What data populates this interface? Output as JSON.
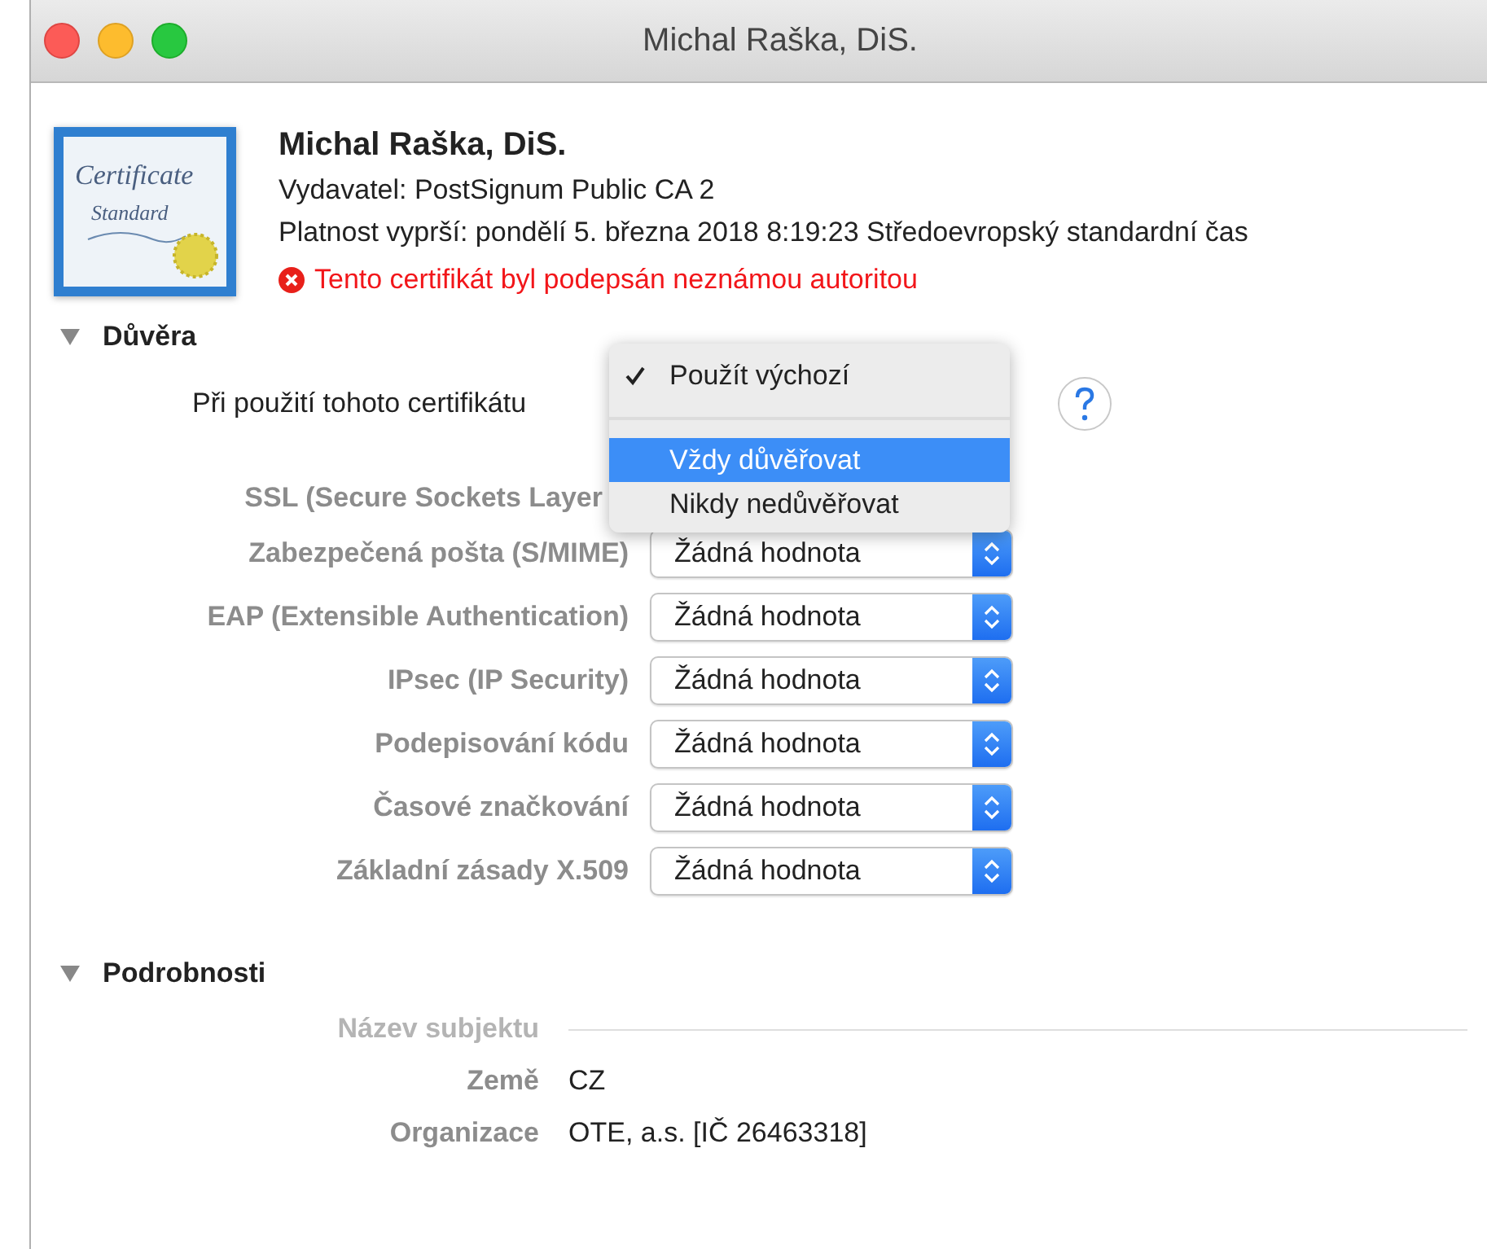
{
  "window": {
    "title": "Michal Raška, DiS."
  },
  "certificate": {
    "icon_lines": [
      "Certificate",
      "Standard"
    ],
    "name": "Michal Raška, DiS.",
    "issuer": "Vydavatel: PostSignum Public CA 2",
    "expiry": "Platnost vyprší: pondělí 5. března 2018 8:19:23 Středoevropský standardní čas",
    "error": "Tento certifikát byl podepsán neznámou autoritou"
  },
  "trust": {
    "title": "Důvěra",
    "expanded": true,
    "usage_label": "Při použití tohoto certifikátu",
    "menu": [
      {
        "label": "Použít výchozí",
        "checked": true,
        "selected": false
      },
      {
        "label": "Vždy důvěřovat",
        "checked": false,
        "selected": true
      },
      {
        "label": "Nikdy nedůvěřovat",
        "checked": false,
        "selected": false
      }
    ],
    "rows": [
      {
        "label": "SSL (Secure Sockets Layer"
      },
      {
        "label": "Zabezpečená pošta (S/MIME)",
        "value": "Žádná hodnota"
      },
      {
        "label": "EAP (Extensible Authentication)",
        "value": "Žádná hodnota"
      },
      {
        "label": "IPsec (IP Security)",
        "value": "Žádná hodnota"
      },
      {
        "label": "Podepisování kódu",
        "value": "Žádná hodnota"
      },
      {
        "label": "Časové značkování",
        "value": "Žádná hodnota"
      },
      {
        "label": "Základní zásady X.509",
        "value": "Žádná hodnota"
      }
    ]
  },
  "details": {
    "title": "Podrobnosti",
    "expanded": true,
    "group": "Název subjektu",
    "fields": [
      {
        "label": "Země",
        "value": "CZ"
      },
      {
        "label": "Organizace",
        "value": "OTE, a.s. [IČ 26463318]"
      }
    ]
  }
}
